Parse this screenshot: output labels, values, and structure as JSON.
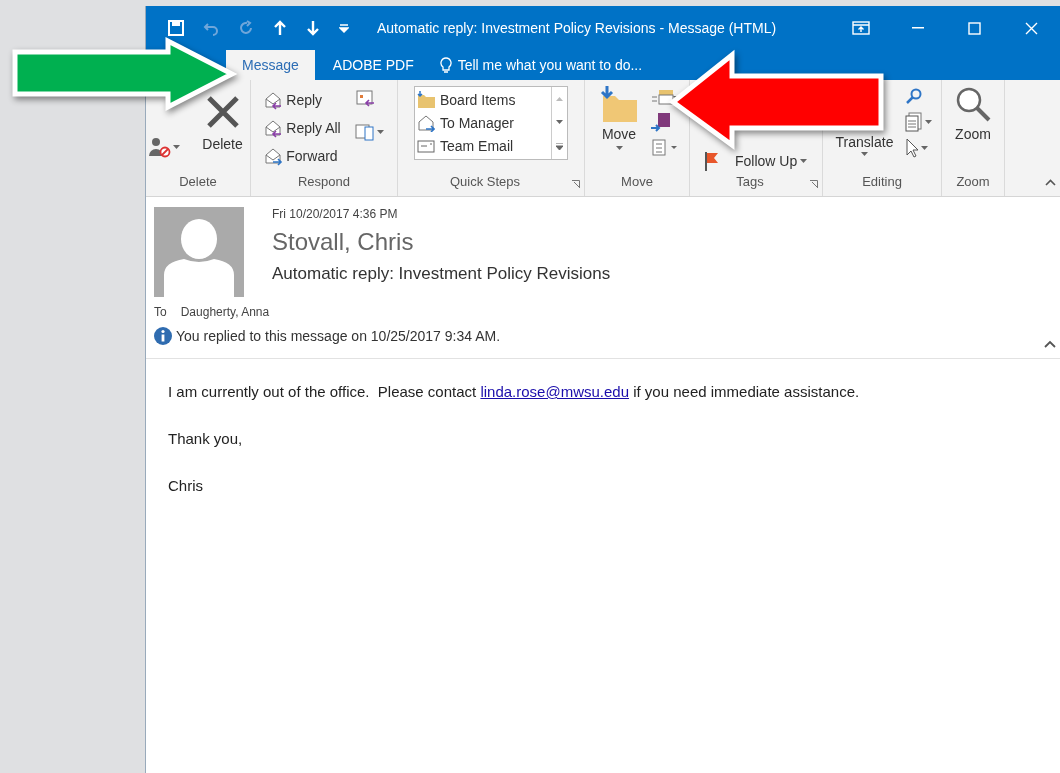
{
  "title_bar": {
    "title": "Automatic reply: Investment Policy Revisions - Message (HTML)"
  },
  "tabs": [
    {
      "label": "Message",
      "selected": true
    },
    {
      "label": "ADOBE PDF",
      "selected": false
    }
  ],
  "tell_me": {
    "placeholder": "Tell me what you want to do..."
  },
  "ribbon": {
    "delete": {
      "label": "Delete",
      "button": "Delete"
    },
    "respond": {
      "label": "Respond",
      "buttons": [
        "Reply",
        "Reply All",
        "Forward"
      ]
    },
    "quick_steps": {
      "label": "Quick Steps",
      "items": [
        "Board Items",
        "To Manager",
        "Team Email"
      ]
    },
    "move": {
      "label": "Move",
      "button": "Move"
    },
    "tags": {
      "label": "Tags",
      "button": "Follow Up"
    },
    "editing": {
      "label": "Editing",
      "button": "Translate"
    },
    "zoom": {
      "label": "Zoom",
      "button": "Zoom"
    }
  },
  "message": {
    "sent": "Fri 10/20/2017 4:36 PM",
    "sender": "Stovall, Chris",
    "subject": "Automatic reply: Investment Policy Revisions",
    "to_label": "To",
    "to": "Daugherty, Anna",
    "info": "You replied to this message on 10/25/2017 9:34 AM."
  },
  "body": [
    {
      "text": "I am currently out of the office.  Please contact ",
      "link": "linda.rose@mwsu.edu",
      "after": " if you need immediate assistance."
    },
    {
      "text": "Thank you,"
    },
    {
      "text": "Chris"
    }
  ]
}
